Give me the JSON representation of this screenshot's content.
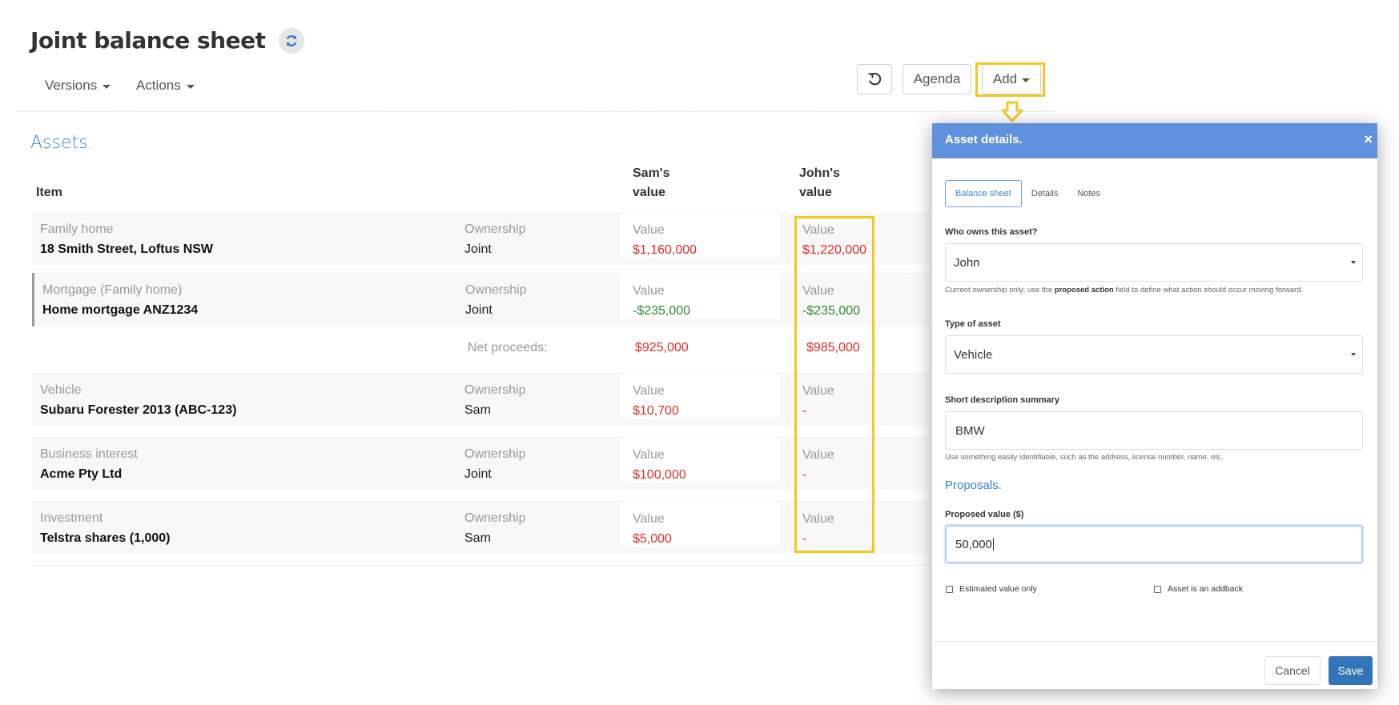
{
  "page": {
    "title": "Joint balance sheet"
  },
  "menus": {
    "versions": "Versions",
    "actions": "Actions"
  },
  "toolbar": {
    "agenda": "Agenda",
    "add": "Add"
  },
  "assets": {
    "section_title": "Assets.",
    "headers": {
      "item": "Item",
      "sam_line1": "Sam's",
      "sam_line2": "value",
      "john_line1": "John's",
      "john_line2": "value"
    },
    "rows": [
      {
        "category": "Family home",
        "name": "18 Smith Street, Loftus NSW",
        "ownership_label": "Ownership",
        "ownership": "Joint",
        "value_label": "Value",
        "sam_value": "$1,160,000",
        "john_value": "$1,220,000"
      },
      {
        "category": "Mortgage (Family home)",
        "name": "Home mortgage ANZ1234",
        "ownership_label": "Ownership",
        "ownership": "Joint",
        "value_label": "Value",
        "sam_value": "-$235,000",
        "john_value": "-$235,000"
      },
      {
        "category": "Vehicle",
        "name": "Subaru Forester 2013 (ABC-123)",
        "ownership_label": "Ownership",
        "ownership": "Sam",
        "value_label": "Value",
        "sam_value": "$10,700",
        "john_value": "-"
      },
      {
        "category": "Business interest",
        "name": "Acme Pty Ltd",
        "ownership_label": "Ownership",
        "ownership": "Joint",
        "value_label": "Value",
        "sam_value": "$100,000",
        "john_value": "-"
      },
      {
        "category": "Investment",
        "name": "Telstra shares (1,000)",
        "ownership_label": "Ownership",
        "ownership": "Sam",
        "value_label": "Value",
        "sam_value": "$5,000",
        "john_value": "-"
      }
    ],
    "net": {
      "label": "Net proceeds:",
      "sam": "$925,000",
      "john": "$985,000"
    }
  },
  "modal": {
    "title": "Asset details.",
    "close": "×",
    "tabs": [
      "Balance sheet",
      "Details",
      "Notes"
    ],
    "owner_label": "Who owns this asset?",
    "owner_value": "John",
    "owner_help_pre": "Current ownership only; use the ",
    "owner_help_bold": "proposed action",
    "owner_help_post": " field to define what action should occur moving forward.",
    "type_label": "Type of asset",
    "type_value": "Vehicle",
    "desc_label": "Short description summary",
    "desc_value": "BMW",
    "desc_help": "Use something easily identifiable, such as the address, license number, name, etc.",
    "proposals_title": "Proposals.",
    "proposed_label": "Proposed value ($)",
    "proposed_value": "50,000",
    "cb_estimated": "Estimated value only",
    "cb_addback": "Asset is an addback",
    "cancel": "Cancel",
    "save": "Save"
  },
  "colors": {
    "accent": "#3b84c9",
    "modal_header": "#6091de",
    "highlight": "#f4c81e",
    "positive": "#e42a2a",
    "negative": "#2e8b2e",
    "save": "#3376b8"
  },
  "icons": {
    "refresh": "refresh-icon",
    "undo": "undo-icon",
    "close": "close-icon"
  }
}
